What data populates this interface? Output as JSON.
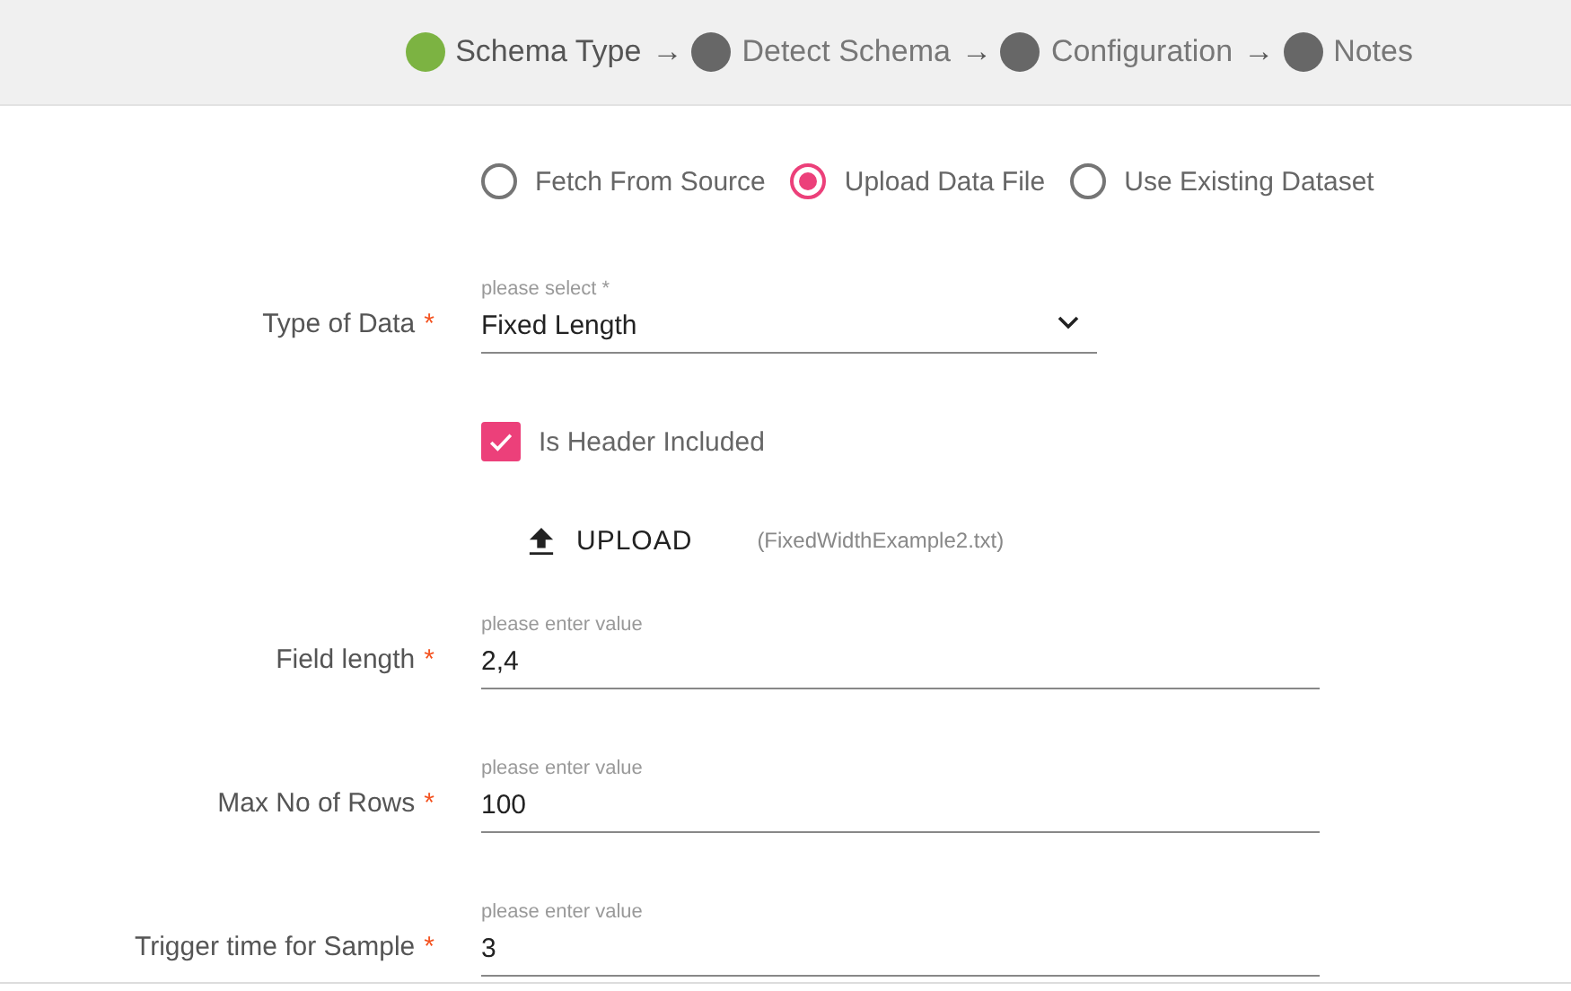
{
  "stepper": [
    {
      "label": "Schema Type",
      "selected": true,
      "separator": "→"
    },
    {
      "label": "Detect Schema",
      "selected": false,
      "separator": "→"
    },
    {
      "label": "Configuration",
      "selected": false,
      "separator": "→"
    },
    {
      "label": "Notes",
      "selected": false
    }
  ],
  "source_options": [
    {
      "label": "Fetch From Source",
      "selected": false
    },
    {
      "label": "Upload Data File",
      "selected": true
    },
    {
      "label": "Use Existing Dataset",
      "selected": false
    }
  ],
  "fields": [
    {
      "kind": "select",
      "label": "Type of Data",
      "required": "*",
      "placeholder": "please select *",
      "value": "Fixed Length"
    },
    {
      "kind": "checkbox",
      "label": "Is Header Included",
      "checked": true
    },
    {
      "kind": "upload",
      "label": "UPLOAD",
      "file": "(FixedWidthExample2.txt)"
    },
    {
      "kind": "text",
      "label": "Field length",
      "required": "*",
      "placeholder": "please enter value",
      "value": "2,4"
    },
    {
      "kind": "text",
      "label": "Max No of Rows",
      "required": "*",
      "placeholder": "please enter value",
      "value": "100"
    },
    {
      "kind": "text",
      "label": "Trigger time for Sample",
      "required": "*",
      "placeholder": "please enter value",
      "value": "3"
    }
  ]
}
